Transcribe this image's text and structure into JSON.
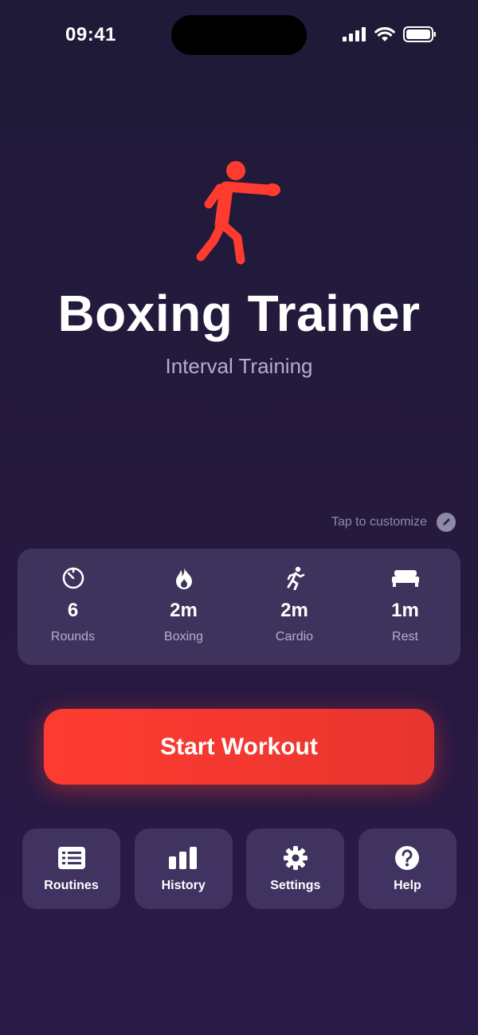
{
  "status_bar": {
    "time": "09:41",
    "icons": [
      "cellular-signal-icon",
      "wifi-icon",
      "battery-icon"
    ]
  },
  "hero": {
    "icon": "boxer-punch-icon",
    "title": "Boxing Trainer",
    "subtitle": "Interval Training"
  },
  "customize": {
    "label": "Tap to customize",
    "icon": "pencil-icon"
  },
  "stats": [
    {
      "icon": "timer-icon",
      "value": "6",
      "label": "Rounds"
    },
    {
      "icon": "flame-icon",
      "value": "2m",
      "label": "Boxing"
    },
    {
      "icon": "running-figure-icon",
      "value": "2m",
      "label": "Cardio"
    },
    {
      "icon": "bed-icon",
      "value": "1m",
      "label": "Rest"
    }
  ],
  "start_button": {
    "label": "Start Workout"
  },
  "nav": [
    {
      "icon": "list-icon",
      "label": "Routines"
    },
    {
      "icon": "bar-chart-icon",
      "label": "History"
    },
    {
      "icon": "gear-icon",
      "label": "Settings"
    },
    {
      "icon": "question-circle-icon",
      "label": "Help"
    }
  ],
  "colors": {
    "accent": "#ff3b30",
    "background_top": "#1f1a38",
    "background_bottom": "#2a1a48",
    "card": "#3c3560",
    "secondary_text": "#b4aecb"
  }
}
